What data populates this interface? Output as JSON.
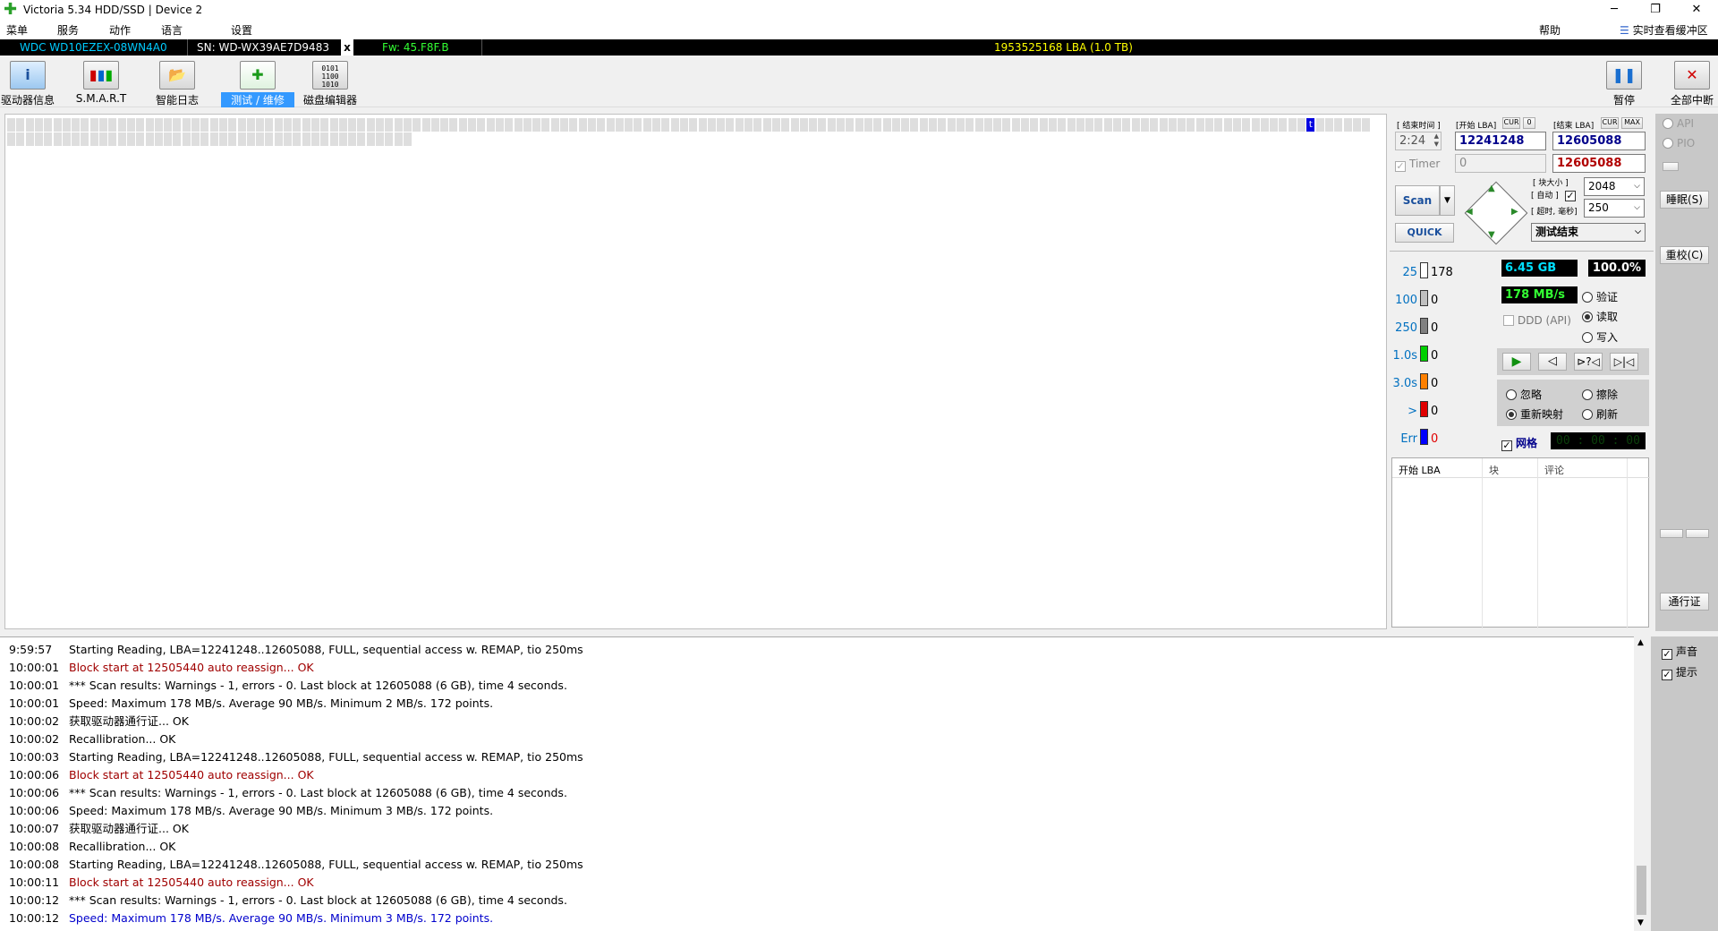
{
  "window": {
    "title": "Victoria 5.34 HDD/SSD | Device 2"
  },
  "menu": [
    "菜单",
    "服务",
    "动作",
    "语言",
    "设置"
  ],
  "menu_right": {
    "help": "帮助",
    "cache": "实时查看缓冲区"
  },
  "device": {
    "model": "WDC WD10EZEX-08WN4A0",
    "serial": "SN: WD-WX39AE7D9483",
    "close": "x",
    "firmware": "Fw: 45.F8F.B",
    "capacity": "1953525168 LBA (1.0 TB)"
  },
  "toolbar": {
    "drive_info": "驱动器信息",
    "smart": "S.M.A.R.T",
    "smart_log": "智能日志",
    "test_repair": "测试 / 维修",
    "disk_editor": "磁盘编辑器",
    "pause": "暂停",
    "abort_all": "全部中断"
  },
  "scan": {
    "end_time_label": "[ 结束时间 ]",
    "start_lba_label": "[开始 LBA]",
    "cur1": "CUR",
    "zero": "0",
    "end_lba_label": "[结束 LBA]",
    "cur2": "CUR",
    "max": "MAX",
    "time": "2:24",
    "start_lba": "12241248",
    "end_lba": "12605088",
    "timer_label": "Timer",
    "timer_value": "0",
    "end_lba2": "12605088",
    "scan_btn": "Scan",
    "quick_btn": "QUICK",
    "block_size_label": "[ 块大小 ]",
    "auto_label": "[ 自动 ]",
    "timeout_label": "[ 超时, 毫秒]",
    "block_size": "2048",
    "timeout": "250",
    "finish_action": "测试结束"
  },
  "stats": {
    "size": "6.45 GB",
    "percent": "100.0%",
    "speed": "178 MB/s",
    "ddd": "DDD (API)",
    "verify": "验证",
    "read": "读取",
    "write": "写入",
    "ignore": "忽略",
    "erase": "擦除",
    "remap": "重新映射",
    "refresh": "刷新",
    "grid": "网格",
    "grid_timer": "00 : 00 : 00"
  },
  "histogram": [
    {
      "k": "25",
      "v": "178",
      "color": "#ffffff"
    },
    {
      "k": "100",
      "v": "0",
      "color": "#c0c0c0"
    },
    {
      "k": "250",
      "v": "0",
      "color": "#808080"
    },
    {
      "k": "1.0s",
      "v": "0",
      "color": "#00d000"
    },
    {
      "k": "3.0s",
      "v": "0",
      "color": "#ff8000"
    },
    {
      "k": ">",
      "v": "0",
      "color": "#e00000"
    },
    {
      "k": "Err",
      "v": "0",
      "color": "#0000ff"
    }
  ],
  "table": {
    "h1": "开始 LBA",
    "h2": "块",
    "h3": "评论"
  },
  "side": {
    "api": "API",
    "pio": "PIO",
    "sleep": "睡眠(S)",
    "recal": "重校(C)",
    "passport": "通行证",
    "sound": "声音",
    "hint": "提示"
  },
  "map": {
    "current_marker": "t"
  },
  "log": [
    {
      "t": "9:59:57",
      "m": "Starting Reading, LBA=12241248..12605088, FULL, sequential access w. REMAP, tio 250ms",
      "c": "#000"
    },
    {
      "t": "10:00:01",
      "m": "Block start at 12505440 auto reassign... OK",
      "c": "#a00000"
    },
    {
      "t": "10:00:01",
      "m": "*** Scan results: Warnings - 1, errors - 0. Last block at 12605088 (6 GB), time 4 seconds.",
      "c": "#000"
    },
    {
      "t": "10:00:01",
      "m": "Speed: Maximum 178 MB/s. Average 90 MB/s. Minimum 2 MB/s. 172 points.",
      "c": "#000"
    },
    {
      "t": "10:00:02",
      "m": "获取驱动器通行证... OK",
      "c": "#000"
    },
    {
      "t": "10:00:02",
      "m": "Recallibration... OK",
      "c": "#000"
    },
    {
      "t": "10:00:03",
      "m": "Starting Reading, LBA=12241248..12605088, FULL, sequential access w. REMAP, tio 250ms",
      "c": "#000"
    },
    {
      "t": "10:00:06",
      "m": "Block start at 12505440 auto reassign... OK",
      "c": "#a00000"
    },
    {
      "t": "10:00:06",
      "m": "*** Scan results: Warnings - 1, errors - 0. Last block at 12605088 (6 GB), time 4 seconds.",
      "c": "#000"
    },
    {
      "t": "10:00:06",
      "m": "Speed: Maximum 178 MB/s. Average 90 MB/s. Minimum 3 MB/s. 172 points.",
      "c": "#000"
    },
    {
      "t": "10:00:07",
      "m": "获取驱动器通行证... OK",
      "c": "#000"
    },
    {
      "t": "10:00:08",
      "m": "Recallibration... OK",
      "c": "#000"
    },
    {
      "t": "10:00:08",
      "m": "Starting Reading, LBA=12241248..12605088, FULL, sequential access w. REMAP, tio 250ms",
      "c": "#000"
    },
    {
      "t": "10:00:11",
      "m": "Block start at 12505440 auto reassign... OK",
      "c": "#a00000"
    },
    {
      "t": "10:00:12",
      "m": "*** Scan results: Warnings - 1, errors - 0. Last block at 12605088 (6 GB), time 4 seconds.",
      "c": "#000"
    },
    {
      "t": "10:00:12",
      "m": "Speed: Maximum 178 MB/s. Average 90 MB/s. Minimum 3 MB/s. 172 points.",
      "c": "#0000cc"
    }
  ]
}
